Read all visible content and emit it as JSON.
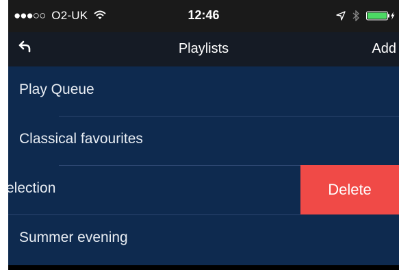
{
  "status": {
    "signal": "●●●○○",
    "carrier": "O2-UK",
    "time": "12:46"
  },
  "navbar": {
    "title": "Playlists",
    "add_label": "Add"
  },
  "playlists": [
    {
      "label": "Play Queue"
    },
    {
      "label": "Classical favourites"
    },
    {
      "label": "election"
    },
    {
      "label": "Summer evening"
    }
  ],
  "delete_label": "Delete",
  "colors": {
    "list_background": "#0e2a4f",
    "delete": "#f04a47",
    "navbar": "#151b25"
  }
}
